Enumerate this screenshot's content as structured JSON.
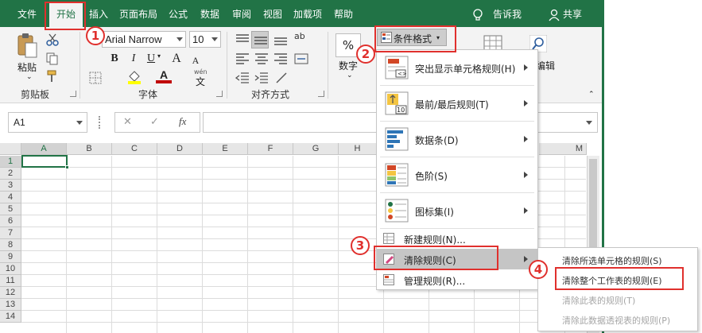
{
  "ribbon": {
    "tabs": [
      "文件",
      "开始",
      "插入",
      "页面布局",
      "公式",
      "数据",
      "审阅",
      "视图",
      "加载项",
      "帮助"
    ],
    "active_tab": "开始",
    "tell_me": "告诉我",
    "share": "共享",
    "clipboard": {
      "paste_label": "粘贴",
      "group_label": "剪贴板"
    },
    "font": {
      "font_name": "Arial Narrow",
      "font_size": "10",
      "bold": "B",
      "italic": "I",
      "underline": "U",
      "grow": "A",
      "shrink": "A",
      "wen": "wén",
      "group_label": "字体"
    },
    "alignment": {
      "wrap_icon": "ab",
      "group_label": "对齐方式"
    },
    "number": {
      "percent": "%",
      "label": "数字"
    },
    "styles": {
      "conditional_format": "条件格式"
    },
    "editing": {
      "label": "编辑"
    }
  },
  "formula_bar": {
    "cell_ref": "A1",
    "cancel": "✕",
    "confirm": "✓",
    "fx": "fx",
    "content": ""
  },
  "grid": {
    "columns": [
      "A",
      "B",
      "C",
      "D",
      "E",
      "F",
      "G",
      "H",
      "M"
    ],
    "rows": [
      "1",
      "2",
      "3",
      "4",
      "5",
      "6",
      "7",
      "8",
      "9",
      "10",
      "11",
      "12",
      "13",
      "14"
    ],
    "selected_cell": "A1"
  },
  "menu": {
    "items": [
      {
        "label": "突出显示单元格规则(H)",
        "has_submenu": true,
        "icon": "highlight-cells-icon"
      },
      {
        "label": "最前/最后规则(T)",
        "has_submenu": true,
        "icon": "top-bottom-icon"
      },
      {
        "label": "数据条(D)",
        "has_submenu": true,
        "icon": "data-bars-icon"
      },
      {
        "label": "色阶(S)",
        "has_submenu": true,
        "icon": "color-scales-icon"
      },
      {
        "label": "图标集(I)",
        "has_submenu": true,
        "icon": "icon-sets-icon"
      },
      {
        "label": "新建规则(N)...",
        "has_submenu": false,
        "icon": "new-rule-icon"
      },
      {
        "label": "清除规则(C)",
        "has_submenu": true,
        "icon": "clear-rules-icon",
        "highlighted": true
      },
      {
        "label": "管理规则(R)...",
        "has_submenu": false,
        "icon": "manage-rules-icon"
      }
    ]
  },
  "submenu": {
    "items": [
      {
        "label": "清除所选单元格的规则(S)",
        "enabled": true
      },
      {
        "label": "清除整个工作表的规则(E)",
        "enabled": true
      },
      {
        "label": "清除此表的规则(T)",
        "enabled": false
      },
      {
        "label": "清除此数据透视表的规则(P)",
        "enabled": false
      }
    ]
  },
  "annotations": [
    "1",
    "2",
    "3",
    "4"
  ],
  "colors": {
    "excel_green": "#217346",
    "annotation_red": "#e0302d",
    "highlight_gray": "#c5c5c5"
  }
}
